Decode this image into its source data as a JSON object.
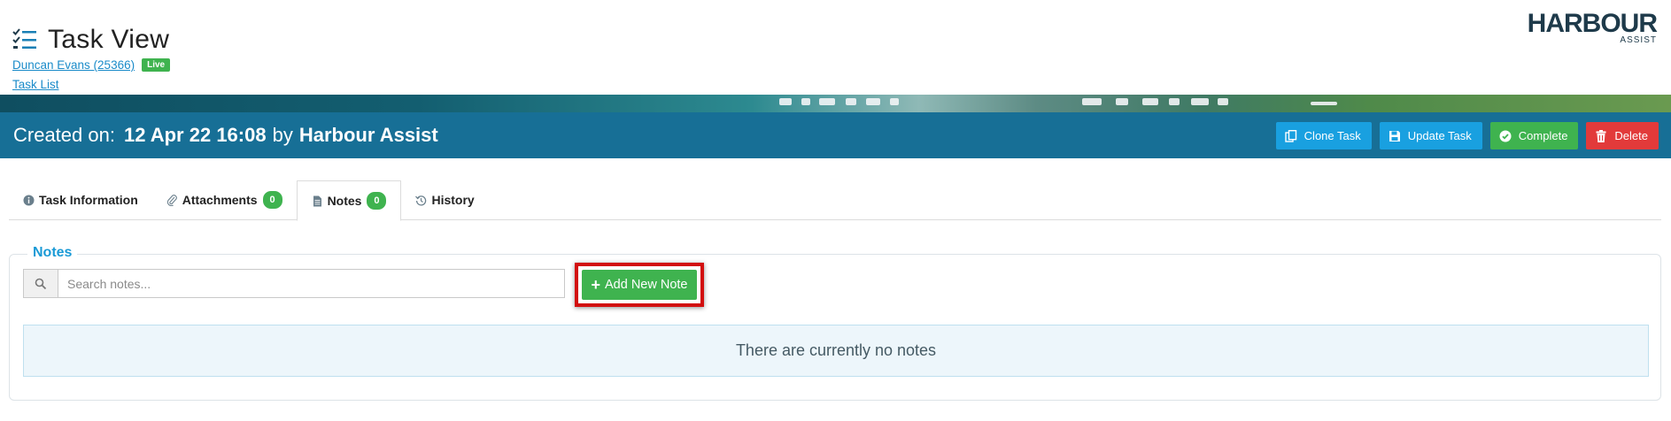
{
  "header": {
    "title": "Task View",
    "customer_link": "Duncan Evans (25366)",
    "status_badge": "Live",
    "tasklist_link": "Task List",
    "logo_main": "HARBOUR",
    "logo_sub": "ASSIST"
  },
  "bluebar": {
    "created_label": "Created on:",
    "created_date": "12 Apr 22 16:08",
    "by_label": "by",
    "created_by": "Harbour Assist",
    "buttons": {
      "clone": "Clone Task",
      "update": "Update Task",
      "complete": "Complete",
      "delete": "Delete"
    }
  },
  "tabs": [
    {
      "label": "Task Information",
      "icon": "info-icon"
    },
    {
      "label": "Attachments",
      "icon": "paperclip-icon",
      "count": "0"
    },
    {
      "label": "Notes",
      "icon": "document-icon",
      "count": "0",
      "active": true
    },
    {
      "label": "History",
      "icon": "history-icon"
    }
  ],
  "notes": {
    "legend": "Notes",
    "search_placeholder": "Search notes...",
    "search_value": "",
    "add_button": "Add New Note",
    "empty_message": "There are currently no notes"
  },
  "colors": {
    "bluebar": "#176f96",
    "accent_blue": "#19a0e0",
    "green": "#3fb34f",
    "red": "#e23a3a",
    "highlight": "#d20e0e"
  }
}
